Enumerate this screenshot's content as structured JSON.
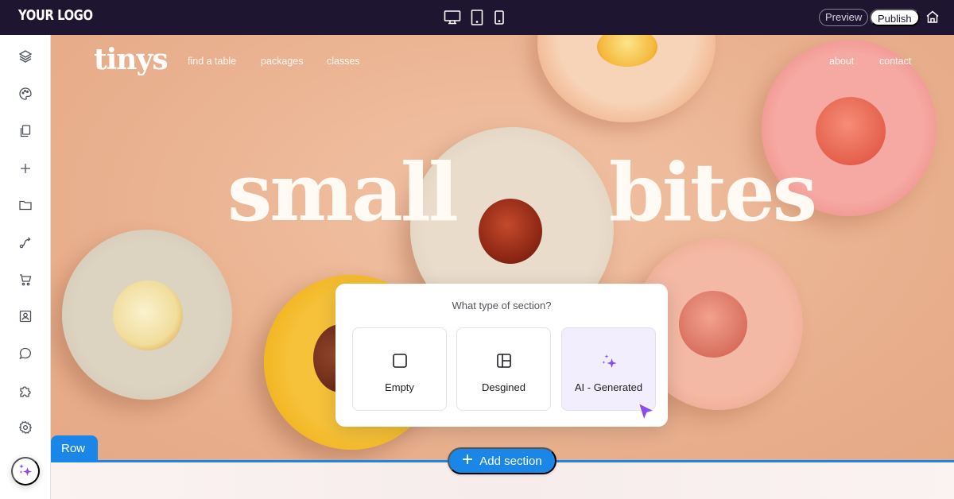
{
  "topbar": {
    "logo": "YOUR LOGO",
    "devices": [
      {
        "name": "desktop",
        "icon": "desktop-icon"
      },
      {
        "name": "tablet",
        "icon": "tablet-icon"
      },
      {
        "name": "mobile",
        "icon": "mobile-icon"
      }
    ],
    "preview_label": "Preview",
    "publish_label": "Publish",
    "home_icon": "home-icon"
  },
  "sidebar": {
    "items": [
      {
        "name": "layers",
        "icon": "layers-icon"
      },
      {
        "name": "theme",
        "icon": "palette-icon"
      },
      {
        "name": "pages",
        "icon": "pages-icon"
      },
      {
        "name": "add",
        "icon": "plus-icon"
      },
      {
        "name": "files",
        "icon": "folder-icon"
      },
      {
        "name": "flows",
        "icon": "route-icon"
      },
      {
        "name": "store",
        "icon": "cart-icon"
      },
      {
        "name": "members",
        "icon": "contact-icon"
      },
      {
        "name": "chat",
        "icon": "chat-icon"
      },
      {
        "name": "plugins",
        "icon": "puzzle-icon"
      },
      {
        "name": "settings",
        "icon": "gear-icon"
      }
    ],
    "ai_button_icon": "sparkles-icon"
  },
  "site": {
    "logo": "tinys",
    "nav_left": [
      "find a table",
      "packages",
      "classes"
    ],
    "nav_right": [
      "about",
      "contact"
    ],
    "hero_left": "small",
    "hero_right": "bites"
  },
  "dialog": {
    "title": "What type of section?",
    "options": [
      {
        "label": "Empty",
        "icon": "square-icon",
        "selected": false
      },
      {
        "label": "Desgined",
        "icon": "layout-icon",
        "selected": false
      },
      {
        "label": "AI - Generated",
        "icon": "sparkles-icon",
        "selected": true
      }
    ]
  },
  "canvas": {
    "row_label": "Row",
    "add_section_label": "Add section"
  },
  "colors": {
    "topbar_bg": "#1e1530",
    "accent_blue": "#1a86e8",
    "ai_purple": "#8b4cf0",
    "canvas_bg": "#eab493"
  }
}
